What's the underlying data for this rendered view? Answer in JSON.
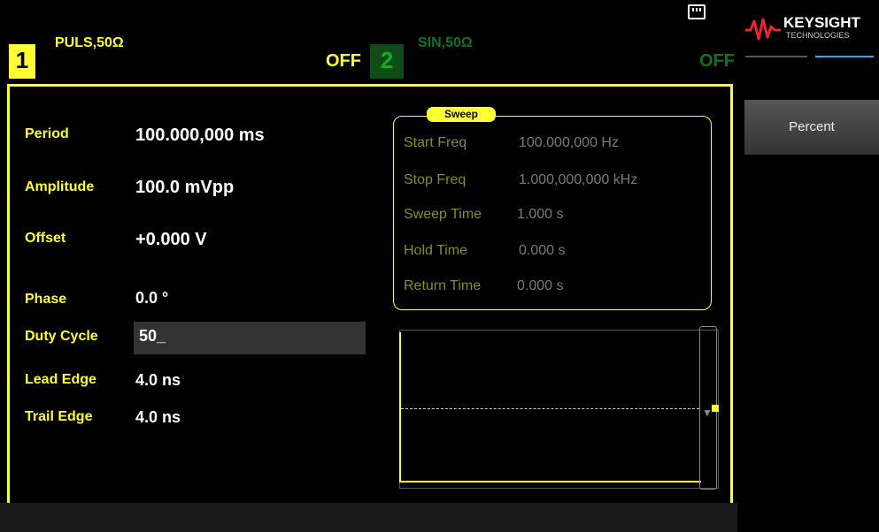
{
  "channel1": {
    "number": "1",
    "mode": "PULS,50Ω",
    "output_state": "OFF"
  },
  "channel2": {
    "number": "2",
    "mode": "SIN,50Ω",
    "output_state": "OFF"
  },
  "params": {
    "period": {
      "label": "Period",
      "value": "100.000,000 ms"
    },
    "amplitude": {
      "label": "Amplitude",
      "value": "100.0 mVpp"
    },
    "offset": {
      "label": "Offset",
      "value": "+0.000 V"
    },
    "phase": {
      "label": "Phase",
      "value": "0.0 °"
    },
    "duty_cycle": {
      "label": "Duty Cycle",
      "value": "50_"
    },
    "lead_edge": {
      "label": "Lead Edge",
      "value": "4.0 ns"
    },
    "trail_edge": {
      "label": "Trail Edge",
      "value": "4.0 ns"
    }
  },
  "sweep": {
    "title": "Sweep",
    "start_freq": {
      "label": "Start Freq",
      "value": "100.000,000 Hz"
    },
    "stop_freq": {
      "label": "Stop Freq",
      "value": "1.000,000,000 kHz"
    },
    "sweep_time": {
      "label": "Sweep Time",
      "value": "1.000 s"
    },
    "hold_time": {
      "label": "Hold Time",
      "value": "0.000 s"
    },
    "return_time": {
      "label": "Return Time",
      "value": "0.000 s"
    }
  },
  "brand": {
    "name": "KEYSIGHT",
    "sub": "TECHNOLOGIES"
  },
  "softkeys": {
    "percent": "Percent"
  },
  "colors": {
    "accent": "#ffff33",
    "channel2": "#13701d",
    "brand_blue": "#3da6e0",
    "logo_red": "#e8262b"
  },
  "icons": {
    "usb": "usb-icon",
    "logo": "keysight-wave-icon"
  }
}
